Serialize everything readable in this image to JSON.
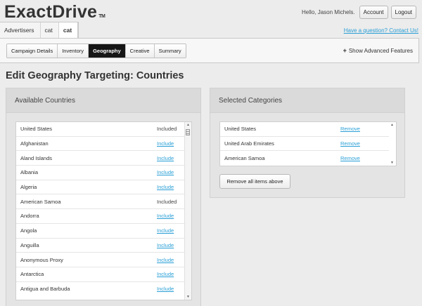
{
  "header": {
    "logo": "ExactDrive",
    "logo_tm": "TM",
    "greeting": "Hello, Jason Michels.",
    "account_label": "Account",
    "logout_label": "Logout",
    "contact_link": "Have a question? Contact Us!"
  },
  "breadcrumb": [
    "Advertisers",
    "cat",
    "cat"
  ],
  "tabs": [
    "Campaign Details",
    "Inventory",
    "Geography",
    "Creative",
    "Summary"
  ],
  "active_tab": "Geography",
  "advanced": {
    "icon": "plus-icon",
    "label": "Show Advanced Features"
  },
  "page_title": "Edit Geography Targeting: Countries",
  "available": {
    "title": "Available Countries",
    "rows": [
      {
        "name": "United States",
        "action": "Included"
      },
      {
        "name": "Afghanistan",
        "action": "Include"
      },
      {
        "name": "Aland Islands",
        "action": "Include"
      },
      {
        "name": "Albania",
        "action": "Include"
      },
      {
        "name": "Algeria",
        "action": "Include"
      },
      {
        "name": "American Samoa",
        "action": "Included"
      },
      {
        "name": "Andorra",
        "action": "Include"
      },
      {
        "name": "Angola",
        "action": "Include"
      },
      {
        "name": "Anguilla",
        "action": "Include"
      },
      {
        "name": "Anonymous Proxy",
        "action": "Include"
      },
      {
        "name": "Antarctica",
        "action": "Include"
      },
      {
        "name": "Antigua and Barbuda",
        "action": "Include"
      }
    ]
  },
  "selected": {
    "title": "Selected Categories",
    "rows": [
      {
        "name": "United States",
        "action": "Remove"
      },
      {
        "name": "United Arab Emirates",
        "action": "Remove"
      },
      {
        "name": "American Samoa",
        "action": "Remove"
      }
    ],
    "remove_all_label": "Remove all items above"
  },
  "colors": {
    "link": "#2a9fd6",
    "active_tab_bg": "#161616",
    "page_bg": "#ececec"
  }
}
